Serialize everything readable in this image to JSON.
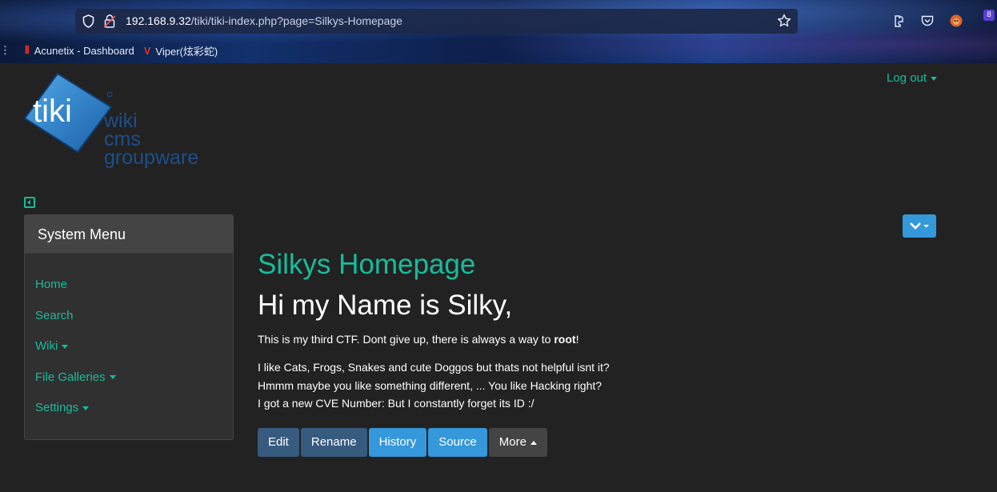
{
  "browser": {
    "url_prefix": "192.168.9.32",
    "url_rest": "/tiki/tiki-index.php?page=Silkys-Homepage",
    "extension_badge": "8",
    "bookmarks": [
      {
        "label": "Acunetix - Dashboard",
        "icon": "acunetix-icon"
      },
      {
        "label": "Viper(炫彩蛇)",
        "icon": "viper-icon"
      }
    ]
  },
  "header": {
    "logout_label": "Log out",
    "logo_line1": "wiki",
    "logo_line2": "cms",
    "logo_line3": "groupware",
    "logo_brand": "tiki"
  },
  "sidebar": {
    "title": "System Menu",
    "items": [
      {
        "label": "Home",
        "dropdown": false
      },
      {
        "label": "Search",
        "dropdown": false
      },
      {
        "label": "Wiki",
        "dropdown": true
      },
      {
        "label": "File Galleries",
        "dropdown": true
      },
      {
        "label": "Settings",
        "dropdown": true
      }
    ]
  },
  "main": {
    "page_title": "Silkys Homepage",
    "heading": "Hi my Name is Silky,",
    "para1_text": "This is my third CTF. Dont give up, there is always a way to ",
    "para1_bold": "root",
    "para1_end": "!",
    "para2_lines": [
      "I like Cats, Frogs, Snakes and cute Doggos but thats not helpful isnt it?",
      "Hmmm maybe you like something different, ... You like Hacking right?",
      "I got a new CVE Number: But I constantly forget its ID :/"
    ]
  },
  "actions": {
    "edit": "Edit",
    "rename": "Rename",
    "history": "History",
    "source": "Source",
    "more": "More"
  },
  "colors": {
    "accent": "#18bc9c",
    "background": "#222222",
    "info": "#3498db",
    "primary": "#375a7f"
  }
}
